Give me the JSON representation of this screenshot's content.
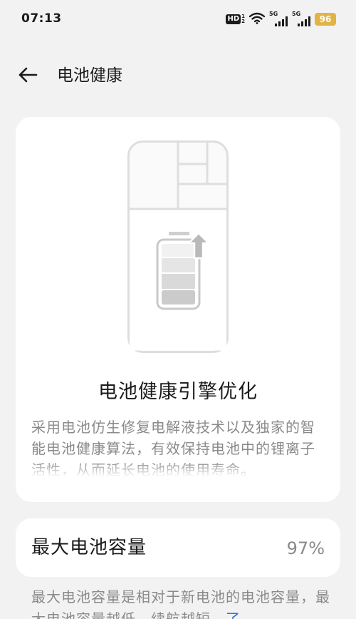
{
  "status_bar": {
    "time": "07:13",
    "hd_label": "HD",
    "hd_sub_top": "1",
    "hd_sub_bottom": "2",
    "network_1": "5G",
    "network_2": "5G",
    "battery_level": "96",
    "icons": [
      "hd-voice-icon",
      "wifi-icon",
      "signal-icon",
      "signal-icon",
      "battery-icon"
    ]
  },
  "header": {
    "back_icon": "arrow-left-icon",
    "title": "电池健康"
  },
  "feature_card": {
    "illustration": "phone-battery-charge-illustration",
    "title": "电池健康引擎优化",
    "description": "采用电池仿生修复电解液技术以及独家的智能电池健康算法，有效保持电池中的锂离子活性，从而延长电池的使用寿命。"
  },
  "capacity": {
    "label": "最大电池容量",
    "value": "97%",
    "note": "最大电池容量是相对于新电池的电池容量，最大电池容量越低，续航越短。",
    "note_link": "了"
  },
  "colors": {
    "background": "#f2f2f2",
    "card": "#ffffff",
    "secondary_text": "#8a8a8a",
    "link": "#2f6fd6",
    "battery_badge": "#e3b443"
  }
}
